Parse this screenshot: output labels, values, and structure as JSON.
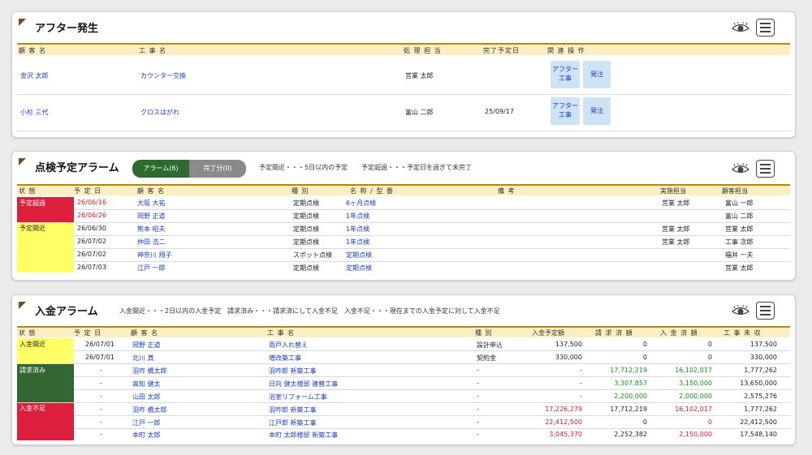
{
  "after": {
    "title": "アフター発生",
    "headers": [
      "顧 客 名",
      "工 事 名",
      "処 理 担 当",
      "完了予定日",
      "関 連 操 作"
    ],
    "rows": [
      {
        "customer": "金沢 太郎",
        "work": "カウンター交換",
        "staff": "営業 太郎",
        "date": "",
        "btn1": "アフター工事",
        "btn2": "発注"
      },
      {
        "customer": "小杉 三代",
        "work": "クロスはがれ",
        "staff": "富山 二郎",
        "date": "25/09/17",
        "btn1": "アフター工事",
        "btn2": "発注"
      }
    ]
  },
  "inspection": {
    "title": "点検予定アラーム",
    "tab_alarm": "アラーム(6)",
    "tab_done": "完了分(0)",
    "desc1": "予定間近・・・5日以内の予定",
    "desc2": "予定超過・・・予定日を過ぎて未完了",
    "headers": [
      "状 態",
      "予 定 日",
      "顧 客 名",
      "種 別",
      "名 称 / 型 番",
      "備 考",
      "実施担当",
      "顧客担当"
    ],
    "status_over": "予定超過",
    "status_near": "予定間近",
    "rows": [
      {
        "date": "26/06/16",
        "customer": "大阪 大祐",
        "type": "定期点検",
        "name": "6ヶ月点検",
        "note": "",
        "exec": "営業 太郎",
        "cust_staff": "富山 一郎"
      },
      {
        "date": "26/06/26",
        "customer": "岡野 正道",
        "type": "定期点検",
        "name": "1年点検",
        "note": "",
        "exec": "",
        "cust_staff": "富山 二郎"
      },
      {
        "date": "26/06/30",
        "customer": "熊本 昭夫",
        "type": "定期点検",
        "name": "1年点検",
        "note": "",
        "exec": "営業 太郎",
        "cust_staff": "営業 太郎"
      },
      {
        "date": "26/07/02",
        "customer": "仲田 浩二",
        "type": "定期点検",
        "name": "1年点検",
        "note": "",
        "exec": "営業 太郎",
        "cust_staff": "工事 次郎"
      },
      {
        "date": "26/07/02",
        "customer": "神奈川 翔子",
        "type": "スポット点検",
        "name": "定期点検",
        "note": "",
        "exec": "",
        "cust_staff": "福井 一夫"
      },
      {
        "date": "26/07/03",
        "customer": "江戸 一郎",
        "type": "定期点検",
        "name": "定期点検",
        "note": "",
        "exec": "",
        "cust_staff": "営業 太郎"
      }
    ]
  },
  "payment": {
    "title": "入金アラーム",
    "desc": "入金間近・・・2日以内の入金予定　請求済み・・・請求済にして入金不足　入金不足・・・現在までの入金予定に対して入金不足",
    "headers": [
      "状 態",
      "予 定 日",
      "顧 客 名",
      "工 事 名",
      "種 別",
      "入金予定額",
      "請 求 済 額",
      "入 金 済 額",
      "工 事 未 収"
    ],
    "status_near": "入金間近",
    "status_billed": "請求済み",
    "status_short": "入金不足",
    "rows": [
      {
        "date": "26/07/01",
        "customer": "岡野 正道",
        "work": "雨戸入れ替え",
        "type": "設計申込",
        "plan": "137,500",
        "billed": "0",
        "paid": "0",
        "unpaid": "137,500"
      },
      {
        "date": "26/07/01",
        "customer": "北川 真",
        "work": "増改築工事",
        "type": "契約金",
        "plan": "330,000",
        "billed": "0",
        "paid": "0",
        "unpaid": "330,000"
      },
      {
        "date": "-",
        "customer": "羽咋 橋太郎",
        "work": "羽咋郎 新築工事",
        "type": "-",
        "plan": "-",
        "billed": "17,712,219",
        "paid": "16,102,017",
        "unpaid": "1,777,262"
      },
      {
        "date": "-",
        "customer": "高知 健太",
        "work": "日向 健太様邸 建替工事",
        "type": "-",
        "plan": "-",
        "billed": "3,307,857",
        "paid": "3,150,000",
        "unpaid": "13,650,000"
      },
      {
        "date": "-",
        "customer": "山田 太郎",
        "work": "浴室リフォーム工事",
        "type": "-",
        "plan": "-",
        "billed": "2,200,000",
        "paid": "2,000,000",
        "unpaid": "2,575,276"
      },
      {
        "date": "-",
        "customer": "羽咋 橋太郎",
        "work": "羽咋郎 新築工事",
        "type": "-",
        "plan": "17,226,279",
        "billed": "17,712,219",
        "paid": "16,102,017",
        "unpaid": "1,777,262"
      },
      {
        "date": "-",
        "customer": "江戸 一郎",
        "work": "江戸郎 新築工事",
        "type": "-",
        "plan": "22,412,500",
        "billed": "0",
        "paid": "0",
        "unpaid": "22,412,500"
      },
      {
        "date": "-",
        "customer": "本町 太郎",
        "work": "本町 太郎様邸 新築工事",
        "type": "-",
        "plan": "3,045,370",
        "billed": "2,252,382",
        "paid": "2,150,000",
        "unpaid": "17,548,140"
      }
    ]
  },
  "colors": {
    "status_over": "#dc1f3c",
    "status_near": "#ffff66",
    "status_billed": "#336633",
    "accent": "#b8860b",
    "header_bg": "#fbeec0"
  }
}
